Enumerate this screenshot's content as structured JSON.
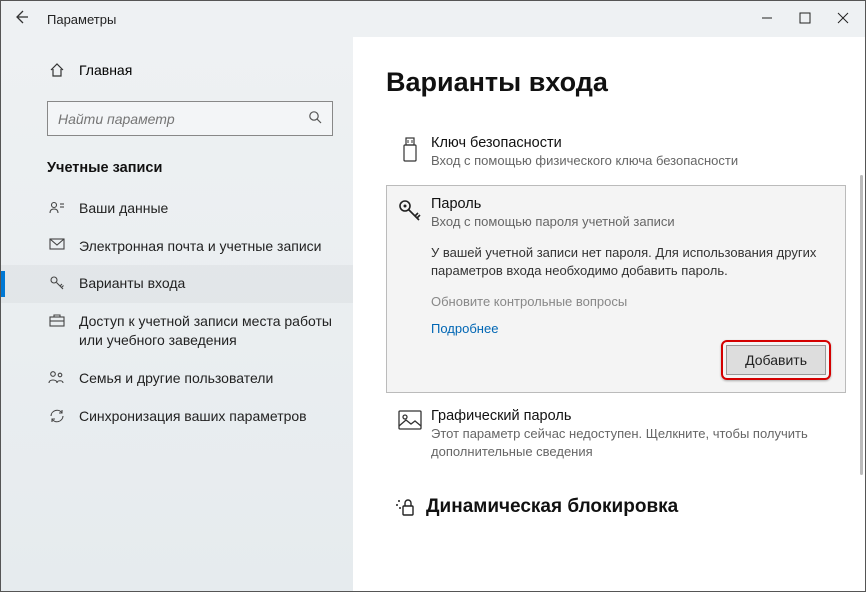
{
  "window": {
    "title": "Параметры"
  },
  "sidebar": {
    "home": "Главная",
    "search_placeholder": "Найти параметр",
    "section": "Учетные записи",
    "items": [
      {
        "label": "Ваши данные"
      },
      {
        "label": "Электронная почта и учетные записи"
      },
      {
        "label": "Варианты входа"
      },
      {
        "label": "Доступ к учетной записи места работы или учебного заведения"
      },
      {
        "label": "Семья и другие пользователи"
      },
      {
        "label": "Синхронизация ваших параметров"
      }
    ]
  },
  "main": {
    "heading": "Варианты входа",
    "security_key": {
      "title": "Ключ безопасности",
      "desc": "Вход с помощью физического ключа безопасности"
    },
    "password": {
      "title": "Пароль",
      "desc": "Вход с помощью пароля учетной записи",
      "info": "У вашей учетной записи нет пароля. Для использования других параметров входа необходимо добавить пароль.",
      "update_questions": "Обновите контрольные вопросы",
      "more": "Подробнее",
      "add_button": "Добавить"
    },
    "picture_password": {
      "title": "Графический пароль",
      "desc": "Этот параметр сейчас недоступен. Щелкните, чтобы получить дополнительные сведения"
    },
    "dynamic_lock": "Динамическая блокировка"
  }
}
